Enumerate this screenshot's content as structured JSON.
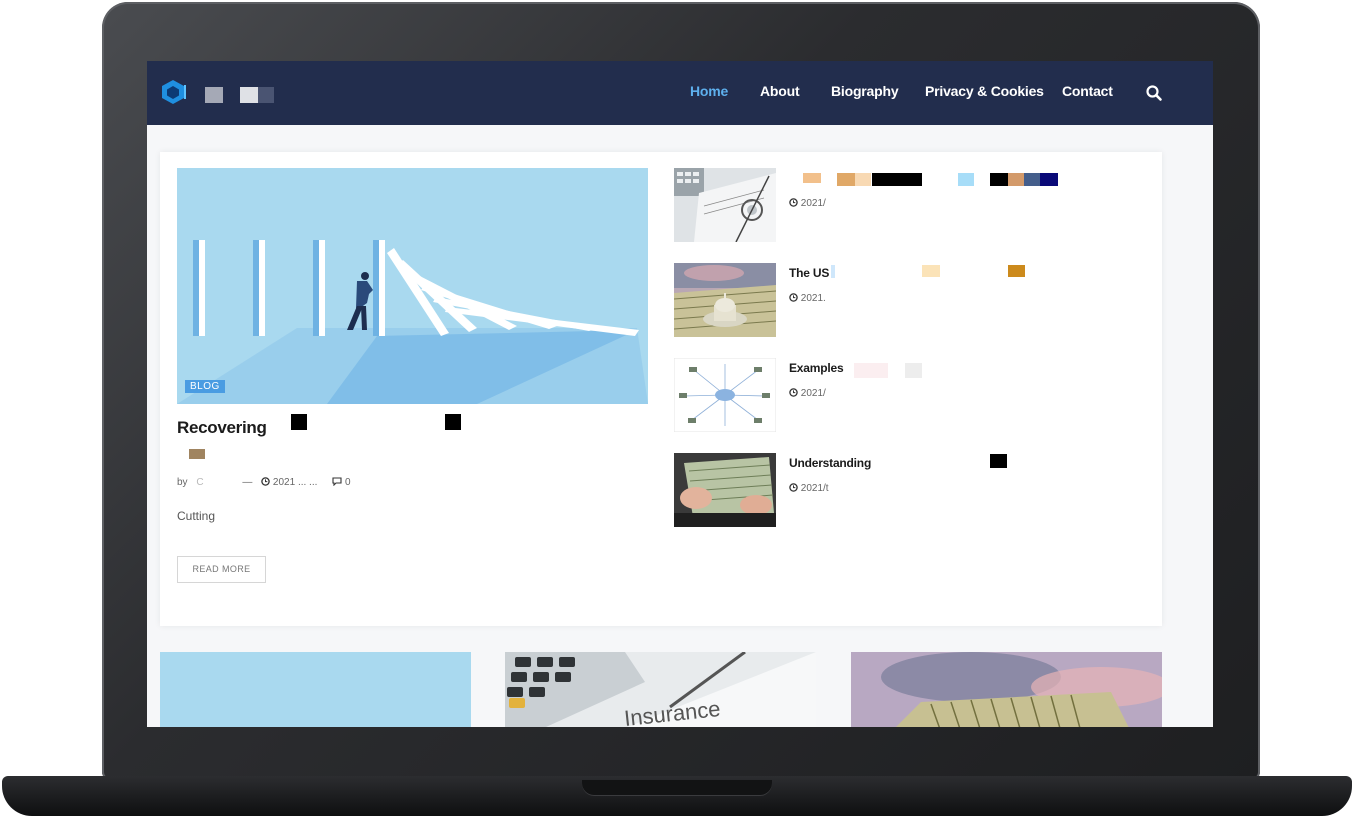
{
  "nav": {
    "items": [
      {
        "label": "Home",
        "active": true
      },
      {
        "label": "About",
        "active": false
      },
      {
        "label": "Biography",
        "active": false
      },
      {
        "label": "Privacy & Cookies",
        "active": false
      },
      {
        "label": "Contact",
        "active": false
      }
    ],
    "search_icon": "search-icon",
    "logo_icon": "hexagon-logo-icon"
  },
  "featured": {
    "category": "BLOG",
    "title": "Recovering",
    "author_prefix": "by",
    "author": "C",
    "date": "2021 ... ...",
    "comments": "0",
    "excerpt": "Cutting",
    "read_more": "READ MORE"
  },
  "side_posts": [
    {
      "title": "",
      "date": "2021/"
    },
    {
      "title": "The US",
      "date": "2021."
    },
    {
      "title": "Examples",
      "date": "2021/"
    },
    {
      "title": "Understanding",
      "date": "2021/t"
    }
  ],
  "colors": {
    "nav_bg": "#222d4d",
    "nav_active": "#5eb0ee",
    "badge": "#4a9ce2",
    "hero_bg": "#a9d9ef"
  }
}
